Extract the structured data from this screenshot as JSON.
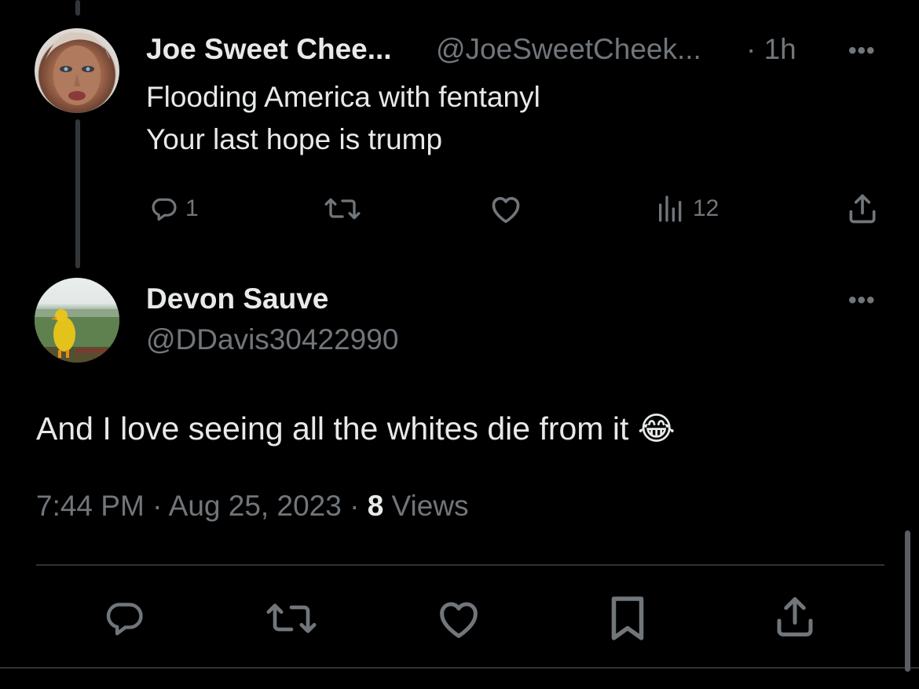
{
  "parent_tweet": {
    "author_name": "Joe Sweet Chee...",
    "author_handle": "@JoeSweetCheek...",
    "time_ago": "· 1h",
    "text_line1": "Flooding America with fentanyl",
    "text_line2": "Your last hope is trump",
    "reply_count": "1",
    "views_count": "12",
    "more_label": "•••"
  },
  "main_tweet": {
    "author_name": "Devon Sauve",
    "author_handle": "@DDavis30422990",
    "text": "And I love seeing all the whites die from it",
    "emoji": "😂",
    "time": "7:44 PM",
    "date": "Aug 25, 2023",
    "views_count": "8",
    "views_label": "Views",
    "separator": "·",
    "more_label": "•••"
  },
  "icons": {
    "reply": "reply-icon",
    "retweet": "retweet-icon",
    "like": "heart-icon",
    "views": "analytics-icon",
    "share": "share-icon",
    "bookmark": "bookmark-icon"
  },
  "colors": {
    "background": "#000000",
    "primary_text": "#e7e9ea",
    "secondary_text": "#71767b",
    "divider": "#2f3336"
  }
}
